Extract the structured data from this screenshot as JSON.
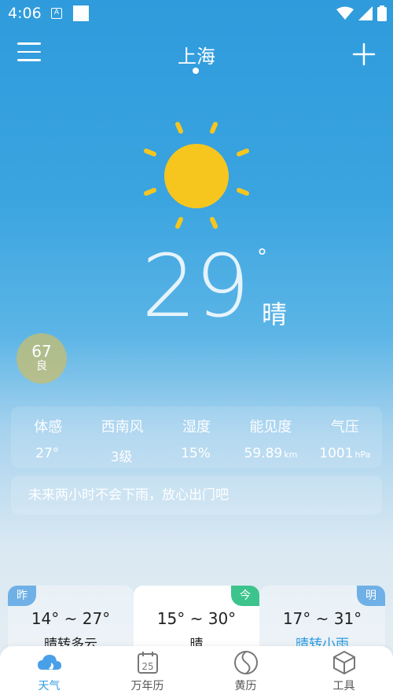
{
  "status_bar": {
    "time": "4:06",
    "notif_icon": "A"
  },
  "header": {
    "city": "上海"
  },
  "current": {
    "temperature": "29",
    "degree_symbol": "°",
    "condition": "晴"
  },
  "aqi": {
    "value": "67",
    "level": "良"
  },
  "details": [
    {
      "label": "体感",
      "value": "27°",
      "unit": ""
    },
    {
      "label": "西南风",
      "value": "3级",
      "unit": ""
    },
    {
      "label": "湿度",
      "value": "15%",
      "unit": ""
    },
    {
      "label": "能见度",
      "value": "59.89",
      "unit": "km"
    },
    {
      "label": "气压",
      "value": "1001",
      "unit": "hPa"
    }
  ],
  "tip": "未来两小时不会下雨，放心出门吧",
  "forecast": [
    {
      "tag": "昨",
      "range": "14° ~ 27°",
      "weather": "晴转多云"
    },
    {
      "tag": "今",
      "range": "15° ~ 30°",
      "weather": "晴"
    },
    {
      "tag": "明",
      "range": "17° ~ 31°",
      "weather": "晴转小雨"
    }
  ],
  "tabs": [
    {
      "label": "天气",
      "icon": "cloud-moon-icon",
      "active": true
    },
    {
      "label": "万年历",
      "icon": "calendar-icon",
      "active": false,
      "badge": "25"
    },
    {
      "label": "黄历",
      "icon": "yin-yang-icon",
      "active": false
    },
    {
      "label": "工具",
      "icon": "cube-icon",
      "active": false
    }
  ],
  "colors": {
    "accent": "#2d9ce0",
    "today_tag": "#3cc48c",
    "tag_blue": "#6fb0e6",
    "sun": "#f6c61f",
    "aqi_bg": "#c8be6e"
  }
}
